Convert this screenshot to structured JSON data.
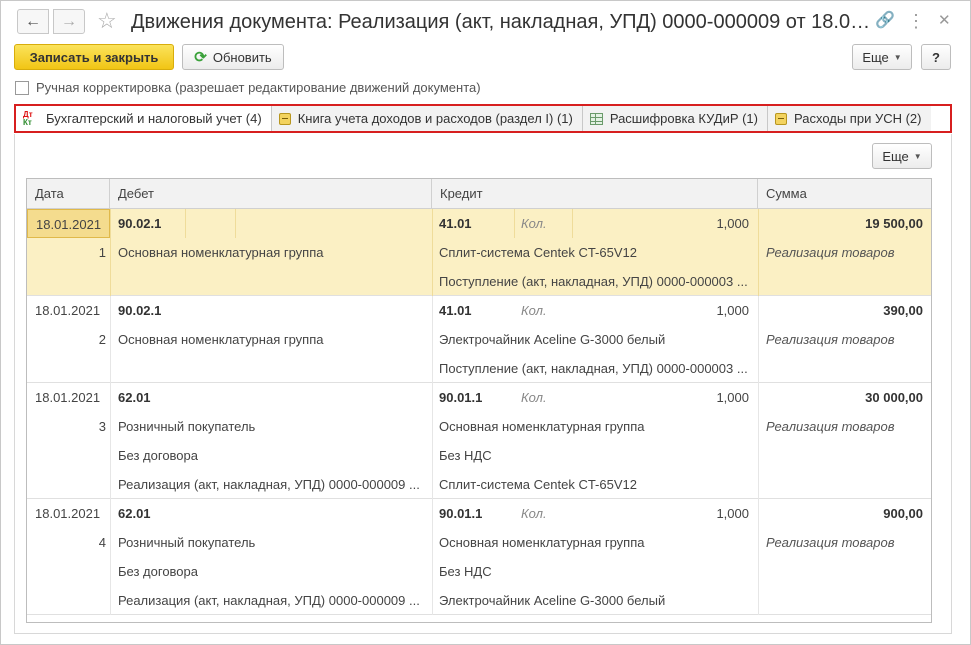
{
  "window": {
    "title": "Движения документа: Реализация (акт, накладная, УПД) 0000-000009 от 18.01.20...",
    "back_icon": "arrow-left-icon",
    "forward_icon": "arrow-right-icon",
    "favorite_icon": "star-icon",
    "link_icon": "link-icon",
    "more_icon": "more-vertical-icon",
    "close_icon": "close-icon"
  },
  "toolbar": {
    "save_close": "Записать и закрыть",
    "refresh": "Обновить",
    "more": "Еще",
    "help": "?"
  },
  "manual_correction": {
    "label": "Ручная корректировка (разрешает редактирование движений документа)",
    "checked": false
  },
  "tabs": [
    {
      "label": "Бухгалтерский и налоговый учет (4)",
      "icon": "dt-kt-icon",
      "active": true
    },
    {
      "label": "Книга учета доходов и расходов (раздел I) (1)",
      "icon": "book-icon",
      "active": false
    },
    {
      "label": "Расшифровка КУДиР (1)",
      "icon": "grid-icon",
      "active": false
    },
    {
      "label": "Расходы при УСН (2)",
      "icon": "book-icon",
      "active": false
    }
  ],
  "table": {
    "more": "Еще",
    "columns": {
      "date": "Дата",
      "debit": "Дебет",
      "credit": "Кредит",
      "sum": "Сумма"
    },
    "qty_label": "Кол.",
    "rows": [
      {
        "date": "18.01.2021",
        "num": "1",
        "debit_account": "90.02.1",
        "debit_lines": [
          "Основная номенклатурная группа"
        ],
        "credit_account": "41.01",
        "qty": "1,000",
        "credit_lines": [
          "Сплит-система Centek CT-65V12",
          "Поступление (акт, накладная, УПД) 0000-000003 ..."
        ],
        "sum": "19 500,00",
        "content": "Реализация товаров"
      },
      {
        "date": "18.01.2021",
        "num": "2",
        "debit_account": "90.02.1",
        "debit_lines": [
          "Основная номенклатурная группа"
        ],
        "credit_account": "41.01",
        "qty": "1,000",
        "credit_lines": [
          "Электрочайник Aceline G-3000 белый",
          "Поступление (акт, накладная, УПД) 0000-000003 ..."
        ],
        "sum": "390,00",
        "content": "Реализация товаров"
      },
      {
        "date": "18.01.2021",
        "num": "3",
        "debit_account": "62.01",
        "debit_lines": [
          "Розничный покупатель",
          "Без договора",
          "Реализация (акт, накладная, УПД) 0000-000009 ..."
        ],
        "credit_account": "90.01.1",
        "qty": "1,000",
        "credit_lines": [
          "Основная номенклатурная группа",
          "Без НДС",
          "Сплит-система Centek CT-65V12"
        ],
        "sum": "30 000,00",
        "content": "Реализация товаров"
      },
      {
        "date": "18.01.2021",
        "num": "4",
        "debit_account": "62.01",
        "debit_lines": [
          "Розничный покупатель",
          "Без договора",
          "Реализация (акт, накладная, УПД) 0000-000009 ..."
        ],
        "credit_account": "90.01.1",
        "qty": "1,000",
        "credit_lines": [
          "Основная номенклатурная группа",
          "Без НДС",
          "Электрочайник Aceline G-3000 белый"
        ],
        "sum": "900,00",
        "content": "Реализация товаров"
      }
    ]
  },
  "colors": {
    "primary_button": "#f1c515",
    "selected_row": "#fbf0c4",
    "tabs_highlight": "#d71f1f"
  }
}
